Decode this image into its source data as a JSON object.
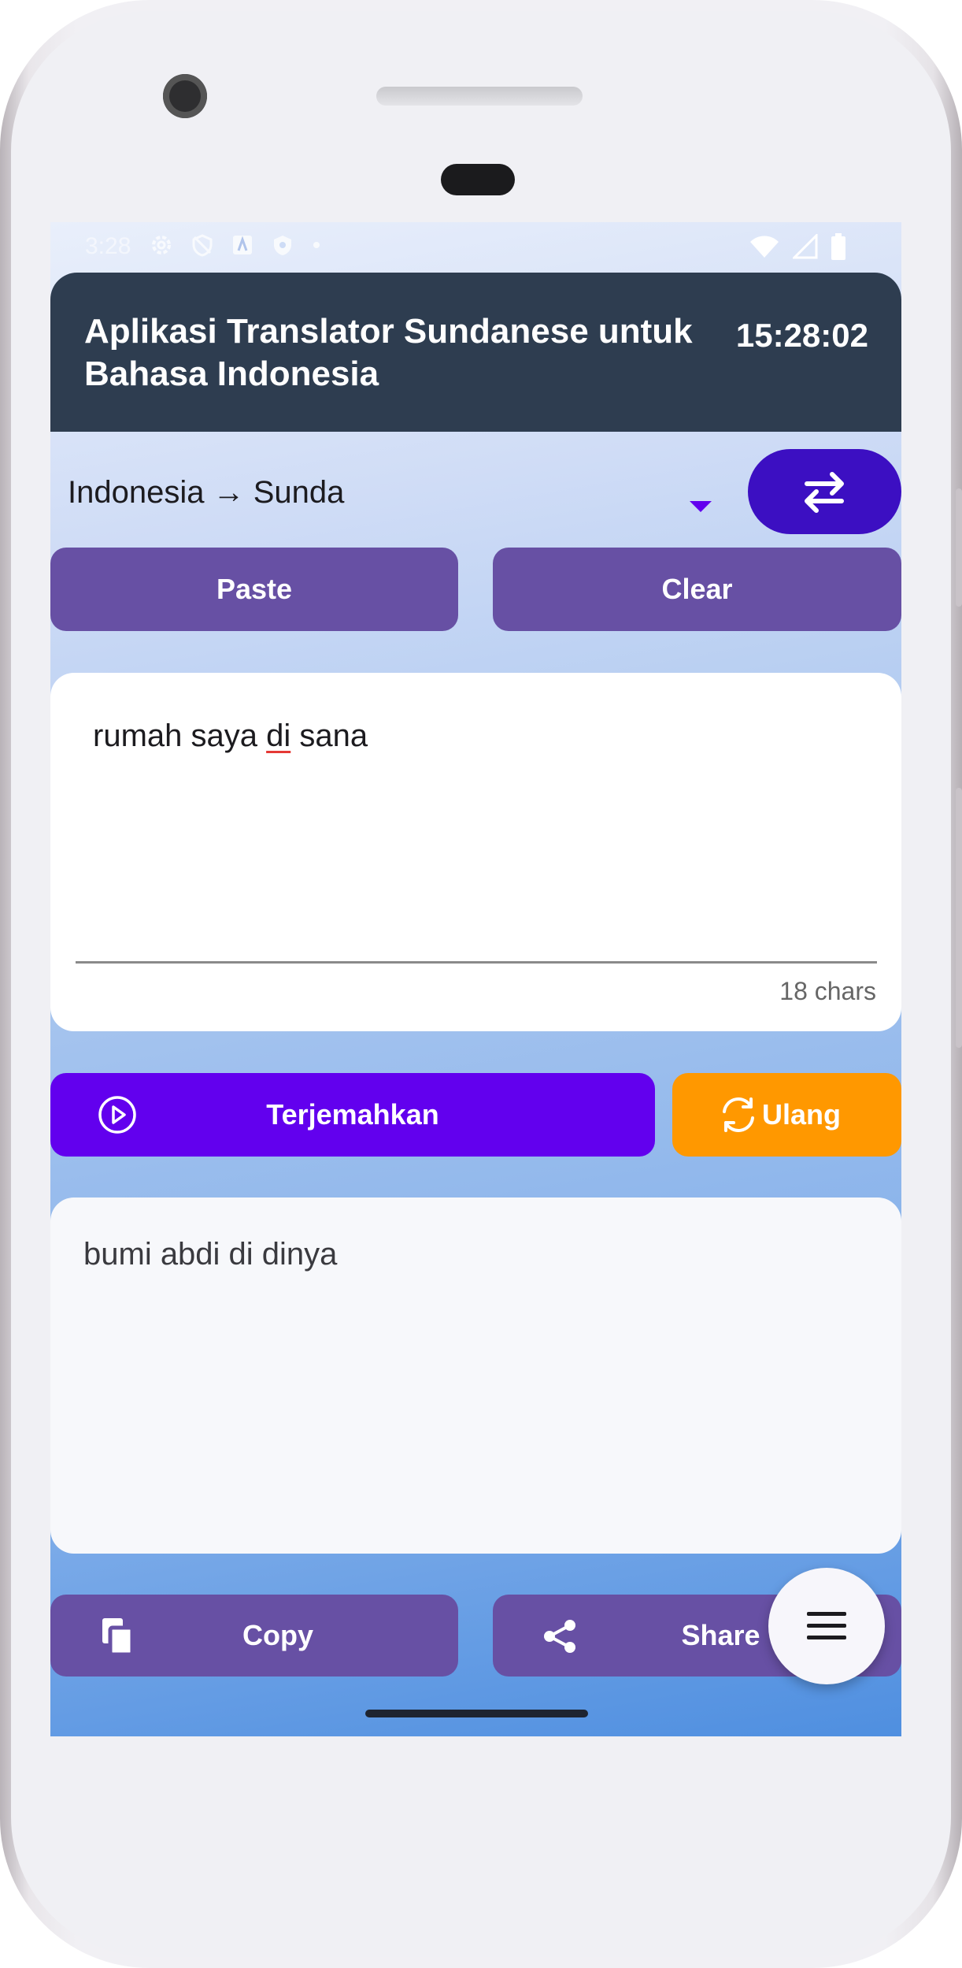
{
  "status_bar": {
    "time": "3:28",
    "left_icons": [
      "gear-icon",
      "shield-off-icon",
      "font-icon",
      "shield-icon",
      "dot-icon"
    ],
    "right_icons": [
      "wifi-icon",
      "signal-icon",
      "battery-icon"
    ]
  },
  "app_bar": {
    "title": "Aplikasi Translator Sundanese untuk Bahasa Indonesia",
    "clock": "15:28:02"
  },
  "language": {
    "selected": "Indonesia → Sunda",
    "dropdown_icon": "caret-down-icon",
    "swap_icon": "swap-arrows-icon"
  },
  "actions": {
    "paste_label": "Paste",
    "clear_label": "Clear"
  },
  "input": {
    "text_before": "rumah saya ",
    "text_flagged": "di",
    "text_after": " sana",
    "char_count": "18 chars"
  },
  "translate": {
    "translate_label": "Terjemahkan",
    "translate_icon": "play-circle-icon",
    "repeat_label": "Ulang",
    "repeat_icon": "refresh-icon",
    "colors": {
      "translate": "#6200ee",
      "repeat": "#ff9800"
    }
  },
  "output": {
    "text": "bumi abdi di dinya"
  },
  "bottom_actions": {
    "copy_label": "Copy",
    "copy_icon": "copy-icon",
    "share_label": "Share",
    "share_icon": "share-icon"
  },
  "fab": {
    "icon": "menu-icon"
  }
}
